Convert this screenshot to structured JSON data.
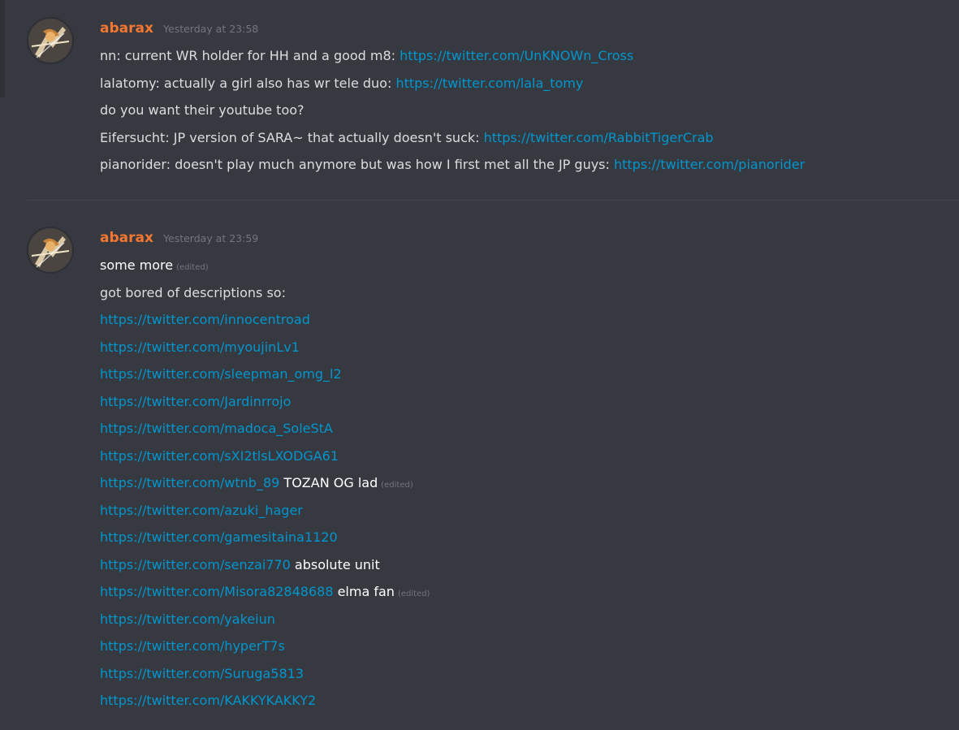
{
  "messages": [
    {
      "username": "abarax",
      "timestamp": "Yesterday at 23:58",
      "lines": [
        {
          "text": "nn: current WR holder for HH and a good m8: ",
          "link": "https://twitter.com/UnKNOWn_Cross"
        },
        {
          "text": "lalatomy: actually a girl also has wr tele duo: ",
          "link": "https://twitter.com/lala_tomy"
        },
        {
          "text": "do you want their youtube too?"
        },
        {
          "text": "Eifersucht: JP version of SARA~ that actually doesn't suck: ",
          "link": "https://twitter.com/RabbitTigerCrab"
        },
        {
          "text": "pianorider: doesn't play much anymore but was how I first met all the JP guys: ",
          "link": "https://twitter.com/pianorider"
        }
      ]
    },
    {
      "username": "abarax",
      "timestamp": "Yesterday at 23:59",
      "lines": [
        {
          "text": "some more",
          "edited": "(edited)"
        },
        {
          "text": "got bored of descriptions so:"
        },
        {
          "link": "https://twitter.com/innocentroad"
        },
        {
          "link": "https://twitter.com/myoujinLv1"
        },
        {
          "link": "https://twitter.com/sleepman_omg_l2"
        },
        {
          "link": "https://twitter.com/Jardinrrojo"
        },
        {
          "link": "https://twitter.com/madoca_SoleStA"
        },
        {
          "link": "https://twitter.com/sXI2tlsLXODGA61"
        },
        {
          "link": "https://twitter.com/wtnb_89",
          "after": " TOZAN OG lad",
          "edited": "(edited)"
        },
        {
          "link": "https://twitter.com/azuki_hager"
        },
        {
          "link": "https://twitter.com/gamesitaina1120"
        },
        {
          "link": "https://twitter.com/senzai770",
          "after": " absolute unit"
        },
        {
          "link": "https://twitter.com/Misora82848688",
          "after": " elma fan",
          "edited": "(edited)"
        },
        {
          "link": "https://twitter.com/yakeiun"
        },
        {
          "link": "https://twitter.com/hyperT7s"
        },
        {
          "link": "https://twitter.com/Suruga5813"
        },
        {
          "link": "https://twitter.com/KAKKYKAKKY2"
        }
      ]
    }
  ],
  "colors": {
    "background": "#36393f",
    "username": "#f57731",
    "link": "#0096cf",
    "text": "#dcddde",
    "muted": "#72767d"
  }
}
